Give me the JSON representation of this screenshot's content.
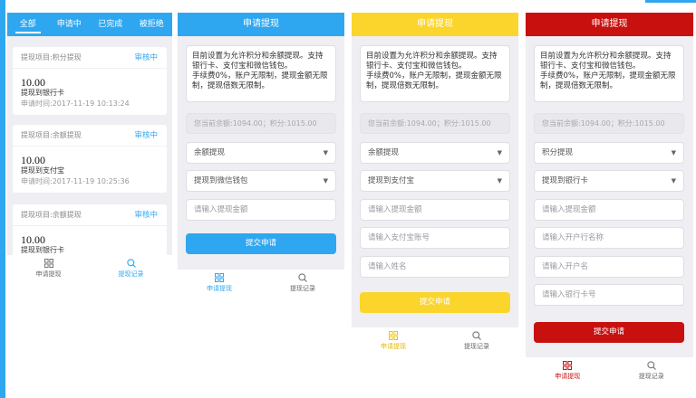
{
  "theme": {
    "blue": "#2ea7f0",
    "yellow": "#fbd52c",
    "red": "#c8100f",
    "panel_bg": "#eeeef3",
    "page_bg": "#ffffff"
  },
  "records": {
    "tabs": [
      "全部",
      "申请中",
      "已完成",
      "被拒绝"
    ],
    "active_tab": "全部",
    "items": [
      {
        "project": "提现项目:积分提现",
        "status": "审核中",
        "amount": "10.00",
        "method": "提现到银行卡",
        "time": "申请时间:2017-11-19 10:13:24"
      },
      {
        "project": "提现项目:余额提现",
        "status": "审核中",
        "amount": "10.00",
        "method": "提现到支付宝",
        "time": "申请时间:2017-11-19 10:25:36"
      },
      {
        "project": "提现项目:余额提现",
        "status": "审核中",
        "amount": "10.00",
        "method": "提现到银行卡"
      }
    ],
    "nav": {
      "apply": "申请提现",
      "history": "提现记录",
      "active": "history"
    }
  },
  "forms": [
    {
      "accent": "#2ea7f0",
      "title": "申请提现",
      "notice": [
        "目前设置为允许积分和余额提现。支持银行卡、支付宝和微信钱包。",
        "手续费0%，账户无限制，提现金额无限制，提现倍数无限制。"
      ],
      "balance": "您当前余额:1094.00；积分:1015.00",
      "selects": [
        "余额提现",
        "提现到微信钱包"
      ],
      "inputs": [
        "请输入提现金额"
      ],
      "submit": "提交申请",
      "nav": {
        "apply": "申请提现",
        "history": "提现记录",
        "active": "apply"
      }
    },
    {
      "accent": "#fbd52c",
      "title": "申请提现",
      "notice": [
        "目前设置为允许积分和余额提现。支持银行卡、支付宝和微信钱包。",
        "手续费0%，账户无限制，提现金额无限制，提现倍数无限制。"
      ],
      "balance": "您当前余额:1094.00；积分:1015.00",
      "selects": [
        "余额提现",
        "提现到支付宝"
      ],
      "inputs": [
        "请输入提现金额",
        "请输入支付宝账号",
        "请输入姓名"
      ],
      "submit": "提交申请",
      "nav": {
        "apply": "申请提现",
        "history": "提现记录",
        "active": "apply"
      }
    },
    {
      "accent": "#c8100f",
      "title": "申请提现",
      "notice": [
        "目前设置为允许积分和余额提现。支持银行卡、支付宝和微信钱包。",
        "手续费0%，账户无限制，提现金额无限制，提现倍数无限制。"
      ],
      "balance": "您当前余额:1094.00；积分:1015.00",
      "selects": [
        "积分提现",
        "提现到银行卡"
      ],
      "inputs": [
        "请输入提现金额",
        "请输入开户行名称",
        "请输入开户名",
        "请输入银行卡号"
      ],
      "submit": "提交申请",
      "nav": {
        "apply": "申请提现",
        "history": "提现记录",
        "active": "apply"
      }
    }
  ]
}
